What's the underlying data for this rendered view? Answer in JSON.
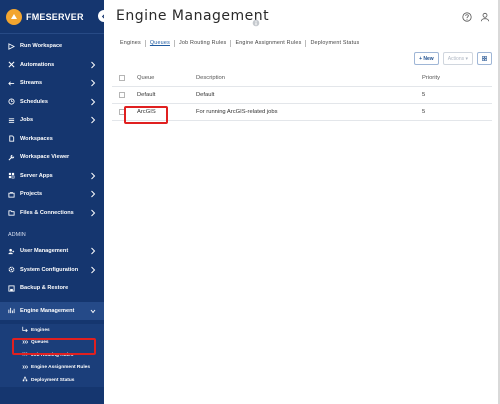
{
  "brand": {
    "name": "FMESERVER"
  },
  "colors": {
    "sidebar_bg": "#15366f",
    "accent": "#1e5aa0",
    "highlight": "#e02020"
  },
  "sidebar": {
    "items": [
      {
        "label": "Run Workspace",
        "icon": "play-icon",
        "chevron": false
      },
      {
        "label": "Automations",
        "icon": "automation-icon",
        "chevron": true
      },
      {
        "label": "Streams",
        "icon": "stream-icon",
        "chevron": true
      },
      {
        "label": "Schedules",
        "icon": "clock-icon",
        "chevron": true
      },
      {
        "label": "Jobs",
        "icon": "list-icon",
        "chevron": true
      },
      {
        "label": "Workspaces",
        "icon": "file-icon",
        "chevron": false
      },
      {
        "label": "Workspace Viewer",
        "icon": "wrench-icon",
        "chevron": false
      },
      {
        "label": "Server Apps",
        "icon": "apps-icon",
        "chevron": true
      },
      {
        "label": "Projects",
        "icon": "briefcase-icon",
        "chevron": true
      },
      {
        "label": "Files & Connections",
        "icon": "folder-icon",
        "chevron": true
      }
    ],
    "admin_label": "ADMIN",
    "admin_items": [
      {
        "label": "User Management",
        "icon": "user-icon",
        "chevron": true
      },
      {
        "label": "System Configuration",
        "icon": "gear-icon",
        "chevron": true
      },
      {
        "label": "Backup & Restore",
        "icon": "backup-icon",
        "chevron": false
      }
    ],
    "engine_management": {
      "label": "Engine Management",
      "icon": "engine-icon"
    },
    "sub_items": [
      {
        "label": "Engines",
        "icon": "arrow-icon"
      },
      {
        "label": "Queues",
        "icon": "queue-icon"
      },
      {
        "label": "Job Routing Rules",
        "icon": "routing-icon"
      },
      {
        "label": "Engine Assignment Rules",
        "icon": "assignment-icon"
      },
      {
        "label": "Deployment Status",
        "icon": "deployment-icon"
      }
    ]
  },
  "header": {
    "title": "Engine Management"
  },
  "tabs": [
    "Engines",
    "Queues",
    "Job Routing Rules",
    "Engine Assignment Rules",
    "Deployment Status"
  ],
  "active_tab": "Queues",
  "toolbar": {
    "new_label": "+ New",
    "actions_label": "Actions ▾"
  },
  "table": {
    "headers": [
      "Queue",
      "Description",
      "Priority"
    ],
    "rows": [
      {
        "queue": "Default",
        "description": "Default",
        "priority": "5"
      },
      {
        "queue": "ArcGIS",
        "description": "For running ArcGIS-related jobs",
        "priority": "5"
      }
    ]
  }
}
